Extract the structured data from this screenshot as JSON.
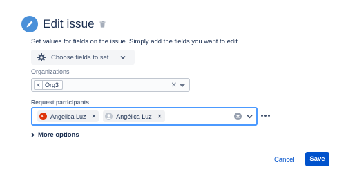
{
  "header": {
    "title": "Edit issue",
    "icon": "pencil-icon",
    "delete_icon": "trash-icon",
    "accent": "#4a90d9"
  },
  "description": "Set values for fields on the issue. Simply add the fields you want to edit.",
  "field_chooser": {
    "label": "Choose fields to set...",
    "icon": "gear-icon"
  },
  "organizations": {
    "label": "Organizations",
    "chips": [
      {
        "label": "Org3"
      }
    ]
  },
  "request_participants": {
    "label": "Request participants",
    "chips": [
      {
        "label": "Angelica Luz",
        "avatar_initials": "AL",
        "avatar_color": "#de350b"
      },
      {
        "label": "Angélica Luz",
        "avatar_initials": "",
        "avatar_color": "#c1c7d0"
      }
    ]
  },
  "more_options": "More options",
  "footer": {
    "cancel_label": "Cancel",
    "save_label": "Save",
    "primary_color": "#0052cc"
  }
}
